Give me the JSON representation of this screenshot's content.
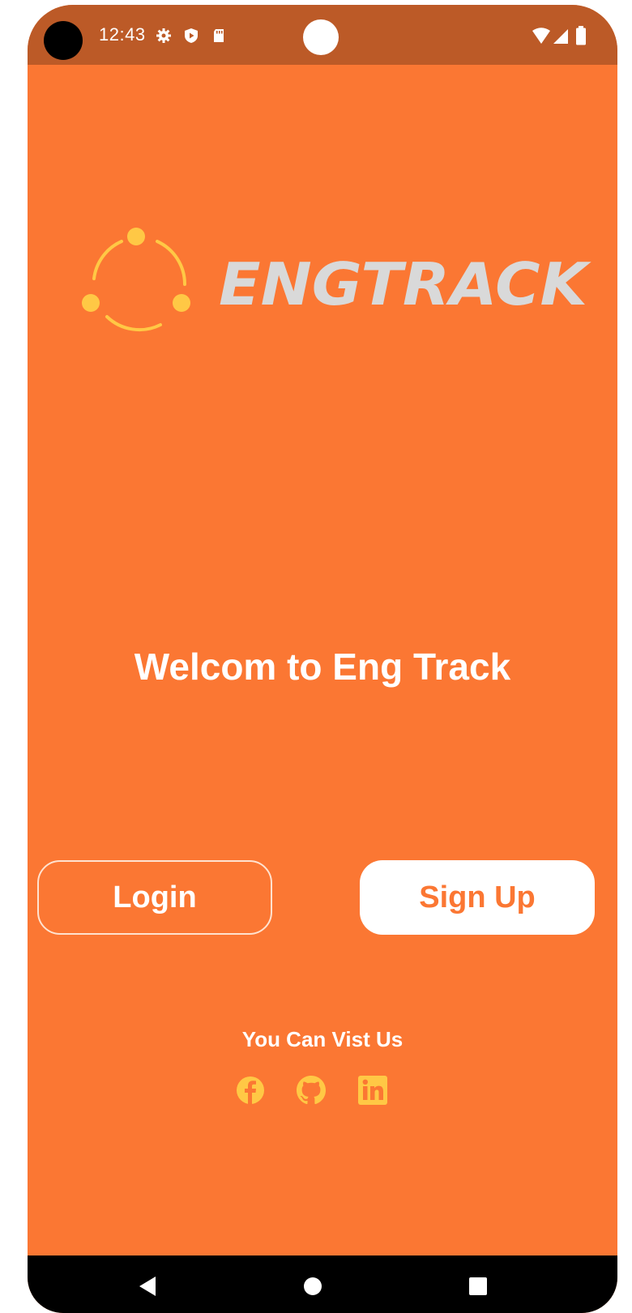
{
  "status_bar": {
    "time": "12:43",
    "icons": [
      "gear-icon",
      "shield-play-icon",
      "sd-card-icon",
      "wifi-icon",
      "signal-icon",
      "battery-icon"
    ]
  },
  "brand": {
    "name": "ENGTRACK",
    "logo_icon": "orbit-dots-icon"
  },
  "welcome": {
    "title": "Welcom to Eng Track"
  },
  "actions": {
    "login_label": "Login",
    "signup_label": "Sign Up"
  },
  "footer": {
    "visit_label": "You Can Vist Us",
    "social_icons": [
      "facebook-icon",
      "github-icon",
      "linkedin-icon"
    ]
  },
  "nav": {
    "icons": [
      "back-icon",
      "home-icon",
      "recents-icon"
    ]
  },
  "colors": {
    "background": "#fb7733",
    "status_bar": "#bc5a27",
    "logo_accent": "#ffc845",
    "brand_text": "#d9d9d9",
    "button_text_accent": "#fb7733",
    "nav_bar": "#000000"
  }
}
